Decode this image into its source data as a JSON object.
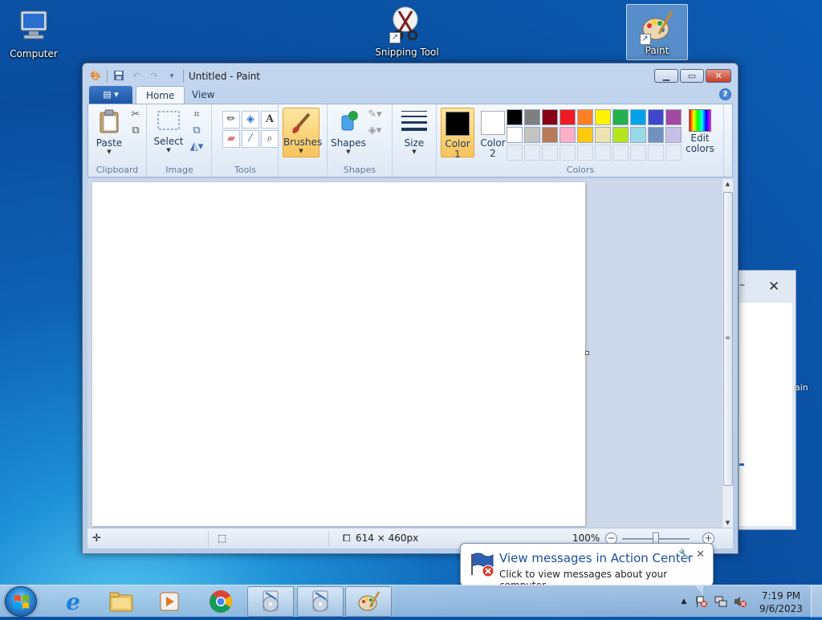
{
  "desktop": {
    "icons": [
      {
        "label": "Computer"
      },
      {
        "label": "Snipping Tool"
      },
      {
        "label": "Paint"
      }
    ],
    "bg_fragment": "ain"
  },
  "window": {
    "title": "Untitled - Paint",
    "controls": {
      "minimize": "▁",
      "maximize": "▭",
      "close": "✕"
    },
    "tabs": {
      "file": "▤ ▾",
      "home": "Home",
      "view": "View",
      "help": "?"
    },
    "ribbon": {
      "clipboard": {
        "paste": "Paste",
        "label": "Clipboard"
      },
      "image": {
        "select": "Select",
        "label": "Image"
      },
      "tools": {
        "label": "Tools"
      },
      "brushes": {
        "label": "Brushes"
      },
      "shapes": {
        "shapes": "Shapes",
        "label": "Shapes"
      },
      "size": {
        "label": "Size"
      },
      "colors": {
        "color1": "Color",
        "color1_num": "1",
        "color2": "Color",
        "color2_num": "2",
        "edit": "Edit",
        "edit2": "colors",
        "label": "Colors",
        "color1_value": "#000000",
        "color2_value": "#ffffff",
        "palette_row1": [
          "#000000",
          "#7f7f7f",
          "#880015",
          "#ed1c24",
          "#ff7f27",
          "#fff200",
          "#22b14c",
          "#00a2e8",
          "#3f48cc",
          "#a349a4"
        ],
        "palette_row2": [
          "#ffffff",
          "#c3c3c3",
          "#b97a57",
          "#ffaec9",
          "#ffc90e",
          "#efe4b0",
          "#b5e61d",
          "#99d9ea",
          "#7092be",
          "#c8bfe7"
        ]
      }
    },
    "status": {
      "image_size": "614 × 460px",
      "zoom": "100%",
      "zoom_level": 1.0
    }
  },
  "notification": {
    "title": "View messages in Action Center",
    "message": "Click to view messages about your computer."
  },
  "taskbar": {
    "time": "7:19 PM",
    "date": "9/6/2023"
  }
}
